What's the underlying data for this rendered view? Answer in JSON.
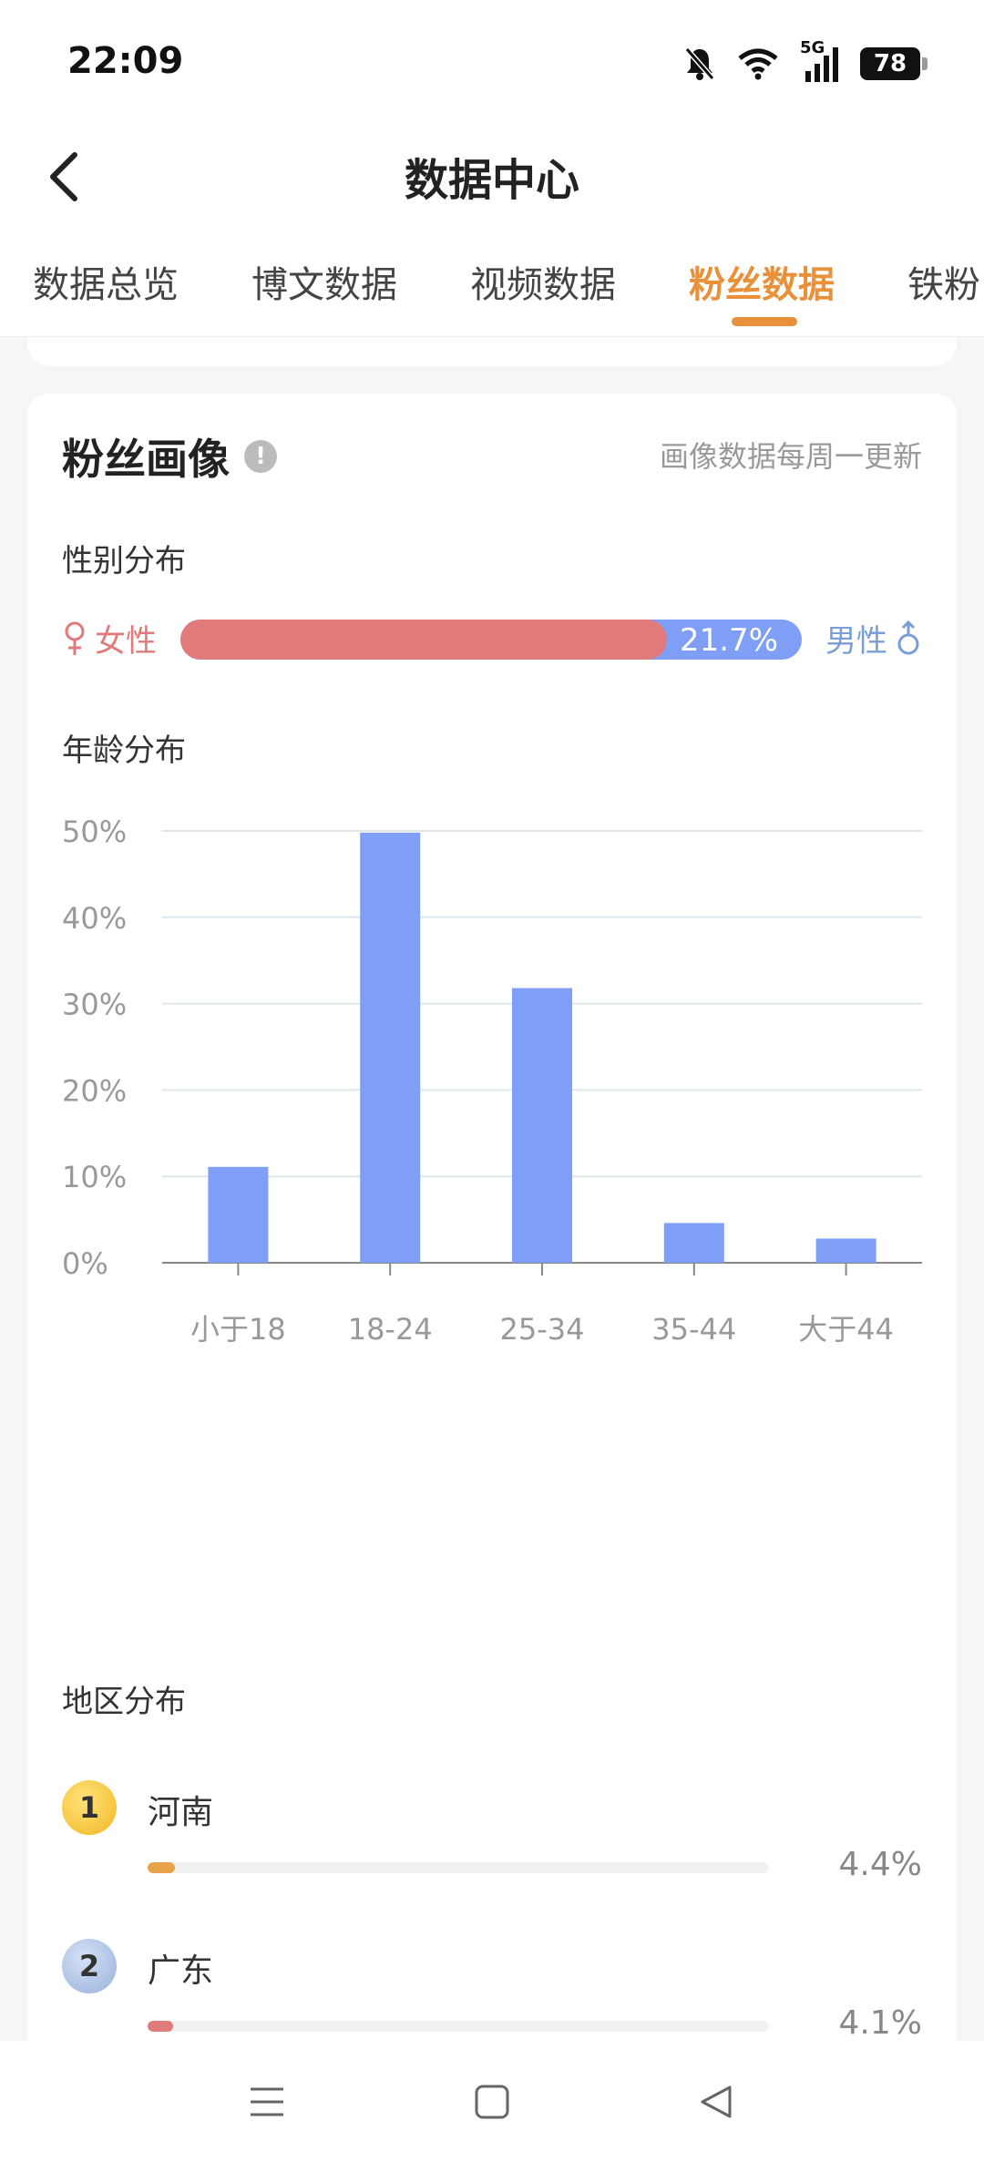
{
  "status_bar": {
    "time": "22:09",
    "network": "5G",
    "battery": "78"
  },
  "nav": {
    "title": "数据中心"
  },
  "tabs": [
    {
      "label": "数据总览",
      "active": false
    },
    {
      "label": "博文数据",
      "active": false
    },
    {
      "label": "视频数据",
      "active": false
    },
    {
      "label": "粉丝数据",
      "active": true
    },
    {
      "label": "铁粉",
      "active": false
    }
  ],
  "fan_profile": {
    "title": "粉丝画像",
    "info_icon": "!",
    "update_note": "画像数据每周一更新",
    "gender": {
      "section_label": "性别分布",
      "female_label": "女性",
      "male_label": "男性",
      "male_percent": "21.7%",
      "female_fraction": 0.783
    },
    "age": {
      "section_label": "年龄分布"
    },
    "region": {
      "section_label": "地区分布",
      "items": [
        {
          "rank": "1",
          "name": "河南",
          "percent": "4.4%",
          "fraction": 0.044
        },
        {
          "rank": "2",
          "name": "广东",
          "percent": "4.1%",
          "fraction": 0.041
        }
      ]
    }
  },
  "chart_data": {
    "type": "bar",
    "categories": [
      "小于18",
      "18-24",
      "25-34",
      "35-44",
      "大于44"
    ],
    "values": [
      11.1,
      49.8,
      31.8,
      4.6,
      2.8
    ],
    "yticks": [
      "0%",
      "10%",
      "20%",
      "30%",
      "40%",
      "50%"
    ],
    "ylim": [
      0,
      50
    ],
    "grid": true,
    "bar_color": "#7f9ff6"
  },
  "colors": {
    "accent": "#e8913a",
    "female": "#e07a7a",
    "male": "#7a9ed6",
    "rank1_fill": "#e8a34a",
    "rank2_fill": "#e17b7b"
  }
}
